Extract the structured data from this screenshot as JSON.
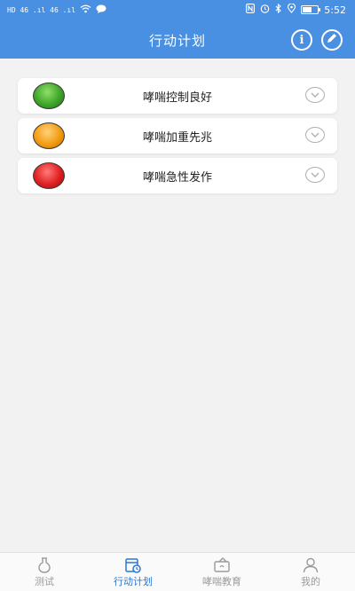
{
  "status_bar": {
    "left_text": "HD 46 .ıl 46 .ıl",
    "time": "5:52",
    "icons": [
      "nfc-icon",
      "alarm-icon",
      "bluetooth-icon",
      "location-icon",
      "battery-icon"
    ]
  },
  "header": {
    "title": "行动计划",
    "info_icon": "info-icon",
    "edit_icon": "edit-pencil-icon"
  },
  "plans": [
    {
      "label": "哮喘控制良好",
      "light_color": "#3fa52a"
    },
    {
      "label": "哮喘加重先兆",
      "light_color": "#f39c12"
    },
    {
      "label": "哮喘急性发作",
      "light_color": "#e02020"
    }
  ],
  "tabs": [
    {
      "label": "测试",
      "icon": "test-icon",
      "active": false
    },
    {
      "label": "行动计划",
      "icon": "action-plan-icon",
      "active": true
    },
    {
      "label": "哮喘教育",
      "icon": "education-icon",
      "active": false
    },
    {
      "label": "我的",
      "icon": "profile-icon",
      "active": false
    }
  ],
  "colors": {
    "primary": "#4a90e2",
    "active_tab": "#2a78d6",
    "inactive_tab": "#9a9a9a",
    "background": "#f2f2f2"
  }
}
